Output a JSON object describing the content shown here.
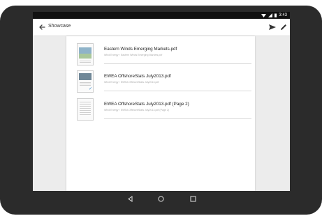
{
  "status_bar": {
    "time": "3:43"
  },
  "app_bar": {
    "title": "Showcase",
    "back_icon": "back-arrow-icon",
    "send_icon": "send-icon",
    "edit_icon": "edit-pencil-icon"
  },
  "documents": [
    {
      "name": "Eastern Winds Emerging Markets.pdf",
      "source": "Wind Energy › Eastern Winds Emerging Markets.pdf",
      "selected": false
    },
    {
      "name": "EWEA OffshoreStats July2013.pdf",
      "source": "Wind Energy › EWEA OffshoreStats July2013.pdf",
      "selected": true
    },
    {
      "name": "EWEA OffshoreStats July2013.pdf (Page 2)",
      "source": "Wind Energy › EWEA OffshoreStats July2013.pdf (Page 2)",
      "selected": false
    }
  ],
  "nav_bar": {
    "back_icon": "nav-back-icon",
    "home_icon": "nav-home-icon",
    "recents_icon": "nav-recents-icon"
  }
}
